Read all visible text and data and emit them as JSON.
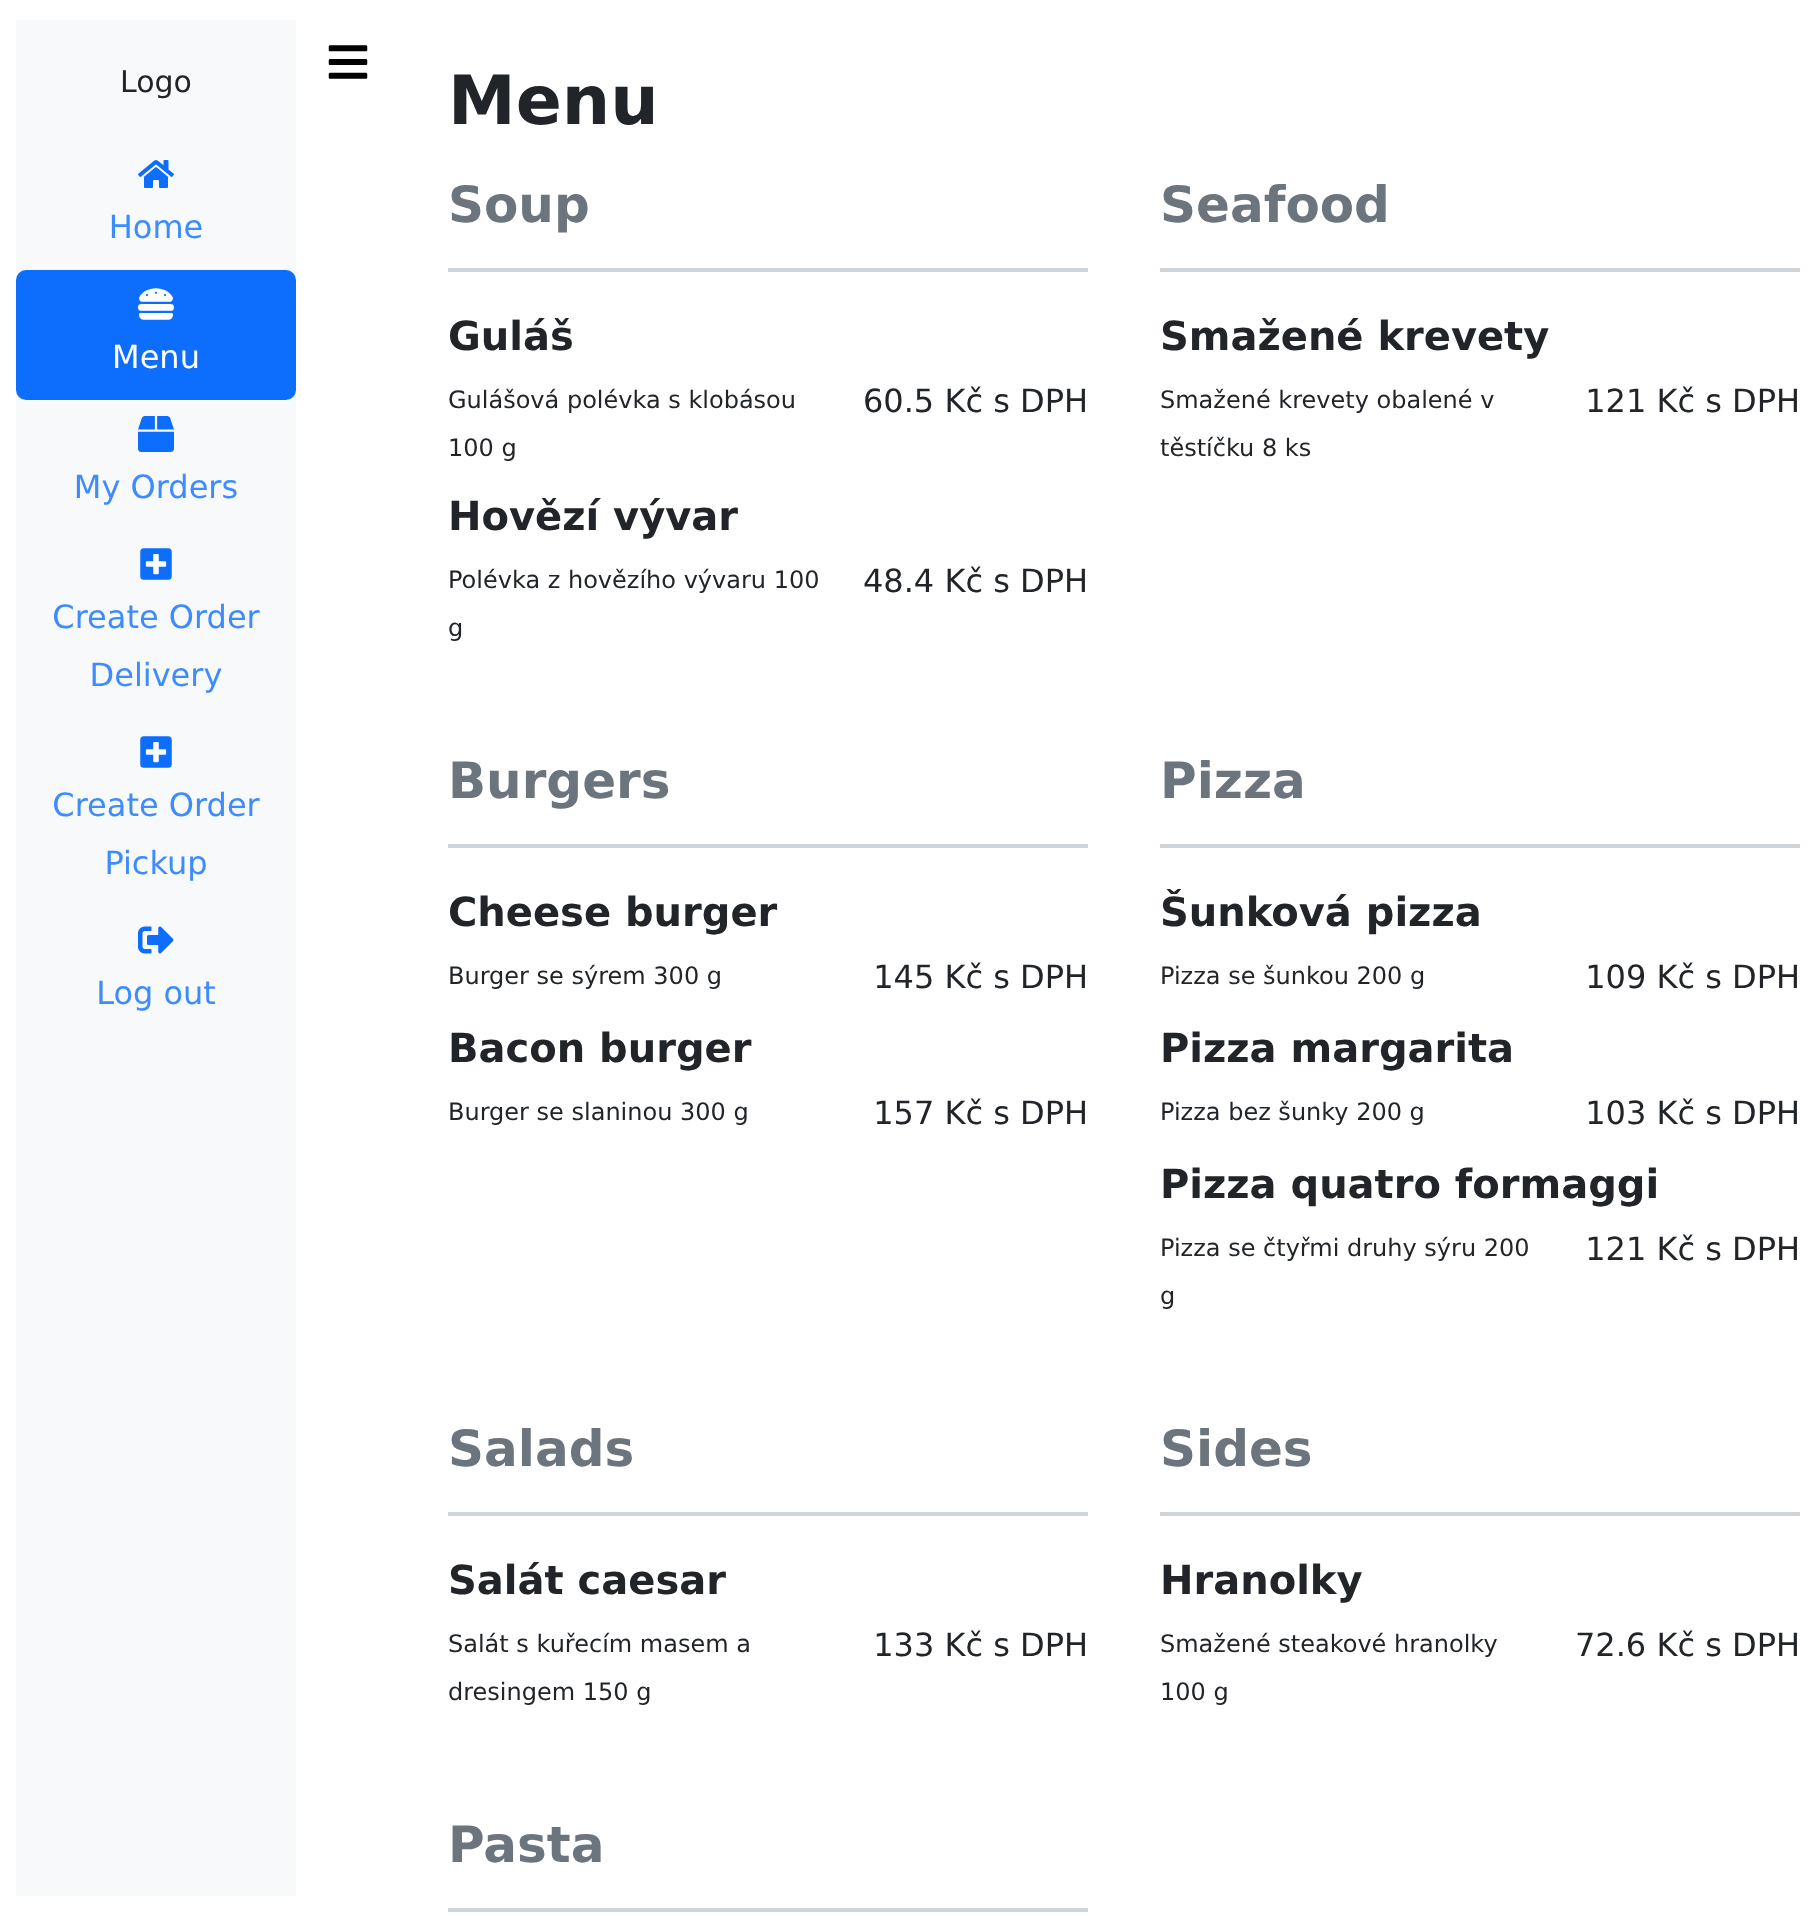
{
  "sidebar": {
    "logo": "Logo",
    "items": [
      {
        "label": "Home",
        "selected": false
      },
      {
        "label": "Menu",
        "selected": true
      },
      {
        "label": "My Orders",
        "selected": false
      },
      {
        "label": "Create Order Delivery",
        "selected": false
      },
      {
        "label": "Create Order Pickup",
        "selected": false
      },
      {
        "label": "Log out",
        "selected": false
      }
    ]
  },
  "page": {
    "title": "Menu",
    "categories": [
      {
        "name": "Soup",
        "items": [
          {
            "name": "Guláš",
            "description": "Gulášová polévka s klobásou 100 g",
            "price": "60.5 Kč s DPH"
          },
          {
            "name": "Hovězí vývar",
            "description": "Polévka z hovězího vývaru 100 g",
            "price": "48.4 Kč s DPH"
          }
        ]
      },
      {
        "name": "Seafood",
        "items": [
          {
            "name": "Smažené krevety",
            "description": "Smažené krevety obalené v těstíčku 8 ks",
            "price": "121 Kč s DPH"
          }
        ]
      },
      {
        "name": "Burgers",
        "items": [
          {
            "name": "Cheese burger",
            "description": "Burger se sýrem 300 g",
            "price": "145 Kč s DPH"
          },
          {
            "name": "Bacon burger",
            "description": "Burger se slaninou 300 g",
            "price": "157 Kč s DPH"
          }
        ]
      },
      {
        "name": "Pizza",
        "items": [
          {
            "name": "Šunková pizza",
            "description": "Pizza se šunkou 200 g",
            "price": "109 Kč s DPH"
          },
          {
            "name": "Pizza margarita",
            "description": "Pizza bez šunky 200 g",
            "price": "103 Kč s DPH"
          },
          {
            "name": "Pizza quatro formaggi",
            "description": "Pizza se čtyřmi druhy sýru 200 g",
            "price": "121 Kč s DPH"
          }
        ]
      },
      {
        "name": "Salads",
        "items": [
          {
            "name": "Salát caesar",
            "description": "Salát s kuřecím masem a dresingem 150 g",
            "price": "133 Kč s DPH"
          }
        ]
      },
      {
        "name": "Sides",
        "items": [
          {
            "name": "Hranolky",
            "description": "Smažené steakové hranolky 100 g",
            "price": "72.6 Kč s DPH"
          }
        ]
      },
      {
        "name": "Pasta"
      }
    ]
  }
}
